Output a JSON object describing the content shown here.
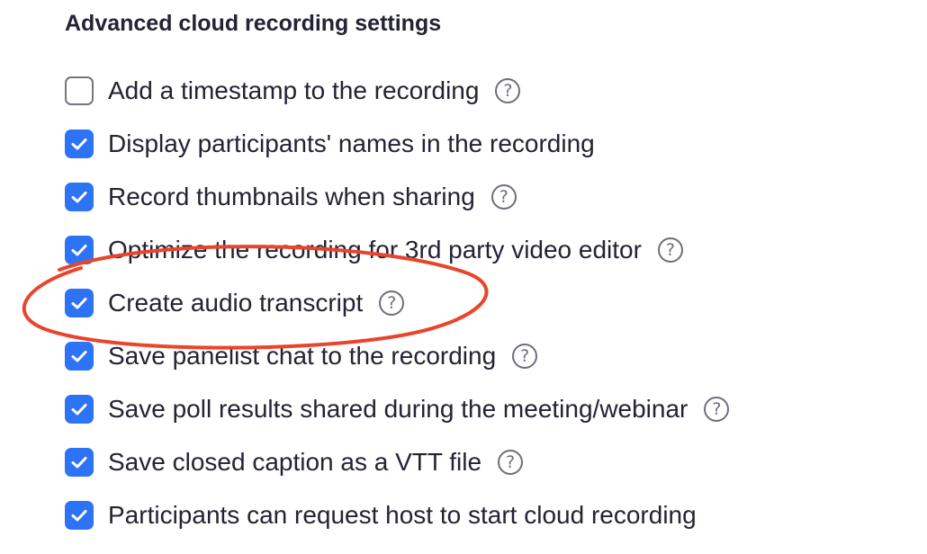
{
  "section": {
    "title": "Advanced cloud recording settings"
  },
  "options": [
    {
      "label": "Add a timestamp to the recording",
      "checked": false,
      "help": "?"
    },
    {
      "label": "Display participants' names in the recording",
      "checked": true
    },
    {
      "label": "Record thumbnails when sharing",
      "checked": true,
      "help": "?"
    },
    {
      "label": "Optimize the recording for 3rd party video editor",
      "checked": true,
      "help": "?"
    },
    {
      "label": "Create audio transcript",
      "checked": true,
      "help": "?"
    },
    {
      "label": "Save panelist chat to the recording",
      "checked": true,
      "help": "?"
    },
    {
      "label": "Save poll results shared during the meeting/webinar",
      "checked": true,
      "help": "?"
    },
    {
      "label": "Save closed caption as a VTT file",
      "checked": true,
      "help": "?"
    },
    {
      "label": "Participants can request host to start cloud recording",
      "checked": true
    }
  ],
  "colors": {
    "checkbox_checked": "#2d73f6",
    "annotation_ellipse": "#e8452c"
  },
  "icons": {
    "help": "question-circle-icon",
    "check": "checkmark-icon"
  }
}
